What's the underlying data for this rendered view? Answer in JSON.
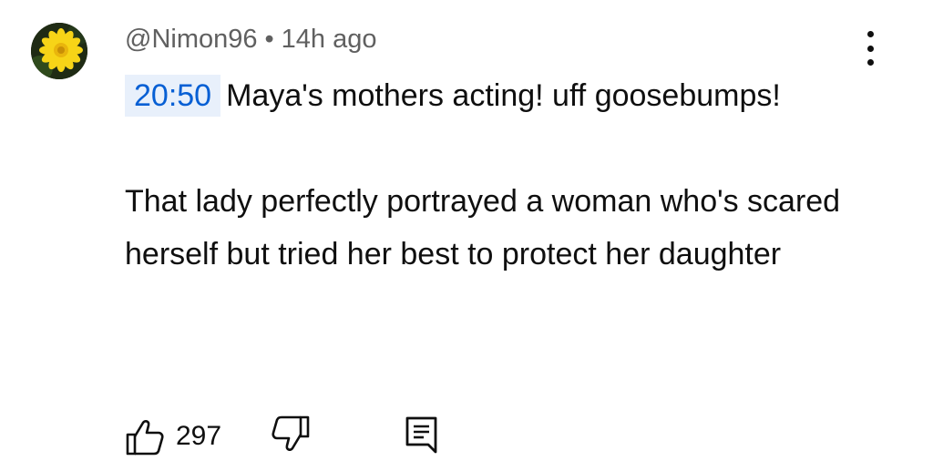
{
  "comment": {
    "author": "@Nimon96",
    "separator": "•",
    "time_ago": "14h ago",
    "timestamp_link": "20:50",
    "text_line1": "Maya's mothers acting! uff goosebumps!",
    "text_para2": "That lady perfectly portrayed a woman who's scared herself but tried her best to protect her daughter",
    "like_count": "297"
  },
  "icons": {
    "avatar": "flower-avatar",
    "menu": "more-vert-icon",
    "like": "thumb-up-icon",
    "dislike": "thumb-down-icon",
    "reply": "comment-reply-icon"
  },
  "colors": {
    "timestamp_text": "#065fd4",
    "timestamp_bg": "#e8f0fb",
    "meta_text": "#606060",
    "text": "#0f0f0f"
  }
}
